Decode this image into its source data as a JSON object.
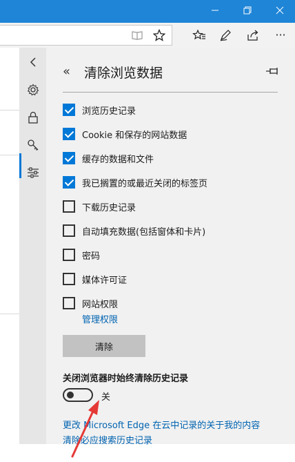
{
  "window": {
    "controls": [
      "minimize-icon",
      "restore-icon",
      "close-icon"
    ]
  },
  "toolbar": {
    "icons": [
      "reading-view-icon",
      "favorite-star-icon",
      "favorites-hub-icon",
      "pen-icon",
      "share-icon",
      "more-icon"
    ],
    "more_label": "···"
  },
  "rail": {
    "icons": [
      "collapse-chevron-icon",
      "gear-icon",
      "lock-icon",
      "key-icon",
      "sliders-icon"
    ],
    "active": "lock-icon"
  },
  "panel": {
    "back_label": "«",
    "title": "清除浏览数据",
    "checkboxes": [
      {
        "label": "浏览历史记录",
        "checked": true
      },
      {
        "label": "Cookie 和保存的网站数据",
        "checked": true
      },
      {
        "label": "缓存的数据和文件",
        "checked": true
      },
      {
        "label": "我已搁置的或最近关闭的标签页",
        "checked": true
      },
      {
        "label": "下载历史记录",
        "checked": false
      },
      {
        "label": "自动填充数据(包括窗体和卡片)",
        "checked": false
      },
      {
        "label": "密码",
        "checked": false
      },
      {
        "label": "媒体许可证",
        "checked": false
      },
      {
        "label": "网站权限",
        "checked": false
      }
    ],
    "manage_link": "管理权限",
    "clear_button": "清除",
    "always_clear_label": "关闭浏览器时始终清除历史记录",
    "toggle_state": "关",
    "links": [
      "更改 Microsoft Edge 在云中记录的关于我的内容",
      "清除必应搜索历史记录"
    ]
  },
  "colors": {
    "accent": "#0078d7",
    "titlebar": "#1f85d7",
    "annotation_arrow": "#e53935",
    "link": "#0063b1"
  }
}
